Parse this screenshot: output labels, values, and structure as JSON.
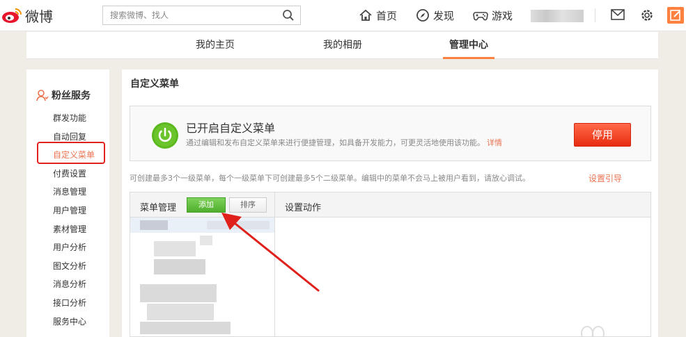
{
  "topbar": {
    "logo_text": "微博",
    "search_placeholder": "搜索微博、找人",
    "nav": [
      {
        "label": "首页",
        "icon": "home-icon"
      },
      {
        "label": "发现",
        "icon": "compass-icon"
      },
      {
        "label": "游戏",
        "icon": "gamepad-icon"
      }
    ],
    "icons": [
      "mail-icon",
      "gear-icon",
      "compose-icon"
    ]
  },
  "tabs": [
    {
      "label": "我的主页",
      "active": false
    },
    {
      "label": "我的相册",
      "active": false
    },
    {
      "label": "管理中心",
      "active": true
    }
  ],
  "sidebar": {
    "section_title": "粉丝服务",
    "items": [
      {
        "label": "群发功能"
      },
      {
        "label": "自动回复"
      },
      {
        "label": "自定义菜单",
        "active": true
      },
      {
        "label": "付费设置"
      },
      {
        "label": "消息管理"
      },
      {
        "label": "用户管理"
      },
      {
        "label": "素材管理"
      },
      {
        "label": "用户分析"
      },
      {
        "label": "图文分析"
      },
      {
        "label": "消息分析"
      },
      {
        "label": "接口分析"
      },
      {
        "label": "服务中心"
      }
    ]
  },
  "main": {
    "title": "自定义菜单",
    "status": {
      "heading": "已开启自定义菜单",
      "description": "通过编辑和发布自定义菜单来进行便捷管理，如具备开发能力，可更灵活地使用该功能。",
      "detail_link": "详情",
      "disable_button": "停用"
    },
    "notice": "可创建最多3个一级菜单，每个一级菜单下可创建最多5个二级菜单。编辑中的菜单不会马上被用户看到，请放心调试。",
    "guide_link": "设置引导",
    "menu_panel": {
      "label": "菜单管理",
      "add_button": "添加",
      "sort_button": "排序",
      "action_label": "设置动作"
    }
  },
  "colors": {
    "accent": "#ff8140",
    "link": "#eb7350",
    "add_green": "#4fae2c",
    "disable_red": "#e82b0f",
    "highlight_red": "#e0211b"
  }
}
